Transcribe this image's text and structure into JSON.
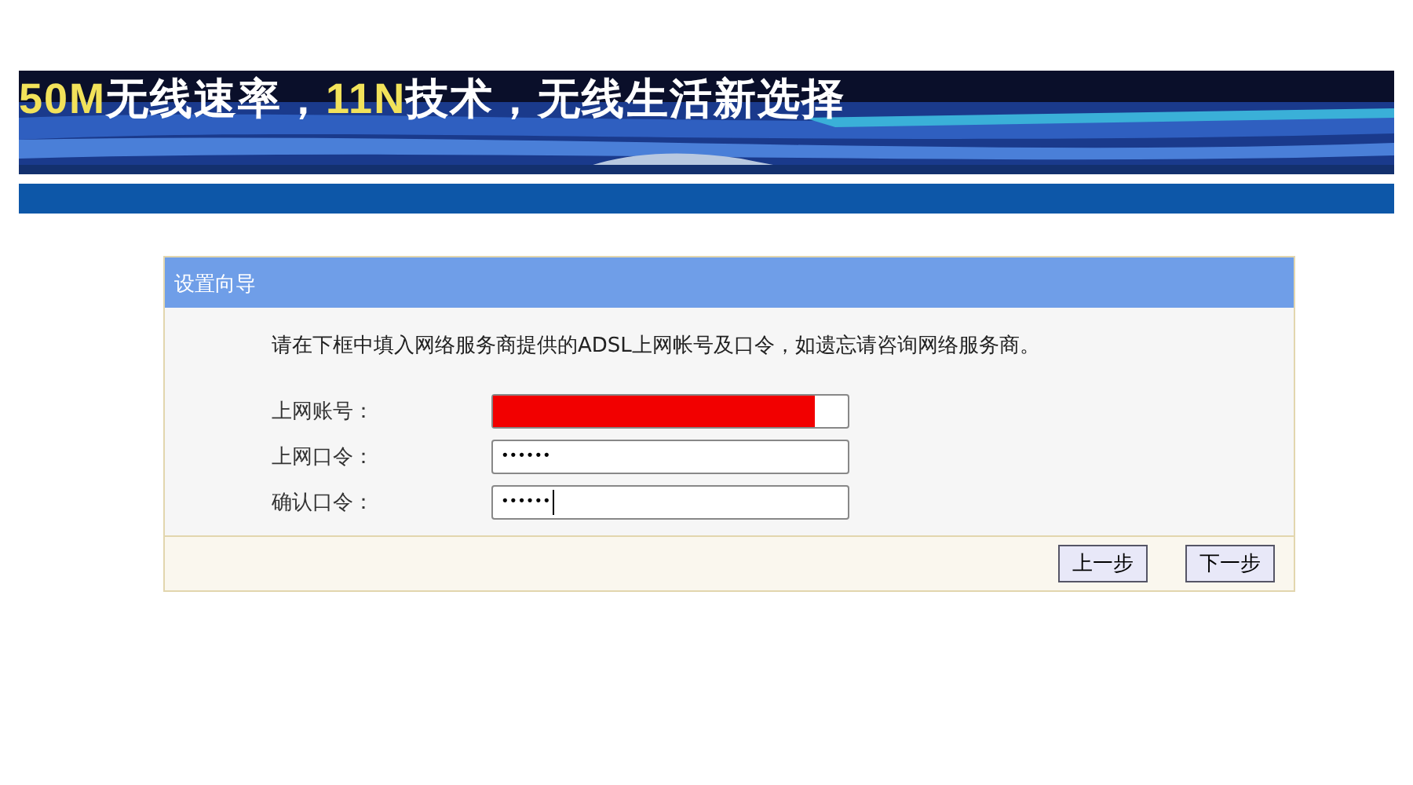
{
  "banner": {
    "slogan": [
      {
        "text": "50M",
        "highlight": true
      },
      {
        "text": "无线速率，",
        "highlight": false
      },
      {
        "text": "11N",
        "highlight": true
      },
      {
        "text": "技术，无线生活新选择",
        "highlight": false
      }
    ]
  },
  "wizard": {
    "title": "设置向导",
    "instructions": "请在下框中填入网络服务商提供的ADSL上网帐号及口令，如遗忘请咨询网络服务商。",
    "fields": [
      {
        "label": "上网账号：",
        "redacted": true,
        "focused": false
      },
      {
        "label": "上网口令：",
        "value": "••••••",
        "redacted": false,
        "focused": false
      },
      {
        "label": "确认口令：",
        "value": "••••••",
        "redacted": false,
        "focused": true
      }
    ],
    "buttons": [
      "上一步",
      "下一步"
    ]
  }
}
